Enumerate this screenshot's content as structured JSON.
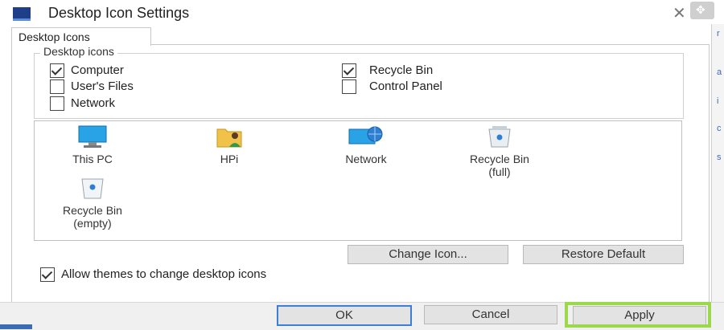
{
  "window": {
    "title": "Desktop Icon Settings",
    "close_glyph": "✕",
    "move_glyph": "✥"
  },
  "tabs": [
    {
      "label": "Desktop Icons"
    }
  ],
  "desktop_icons_group": {
    "legend": "Desktop icons",
    "checkboxes": [
      {
        "label": "Computer",
        "checked": true
      },
      {
        "label": "User's Files",
        "checked": false
      },
      {
        "label": "Network",
        "checked": false
      },
      {
        "label": "Recycle Bin",
        "checked": true
      },
      {
        "label": "Control Panel",
        "checked": false
      }
    ]
  },
  "icon_list": [
    {
      "line1": "This PC",
      "line2": "",
      "icon": "this-pc-icon"
    },
    {
      "line1": "HPi",
      "line2": "",
      "icon": "user-folder-icon"
    },
    {
      "line1": "Network",
      "line2": "",
      "icon": "network-icon"
    },
    {
      "line1": "Recycle Bin",
      "line2": "(full)",
      "icon": "recycle-bin-full-icon"
    },
    {
      "line1": "Recycle Bin",
      "line2": "(empty)",
      "icon": "recycle-bin-empty-icon"
    }
  ],
  "buttons": {
    "change_icon": "Change Icon...",
    "restore_default": "Restore Default",
    "ok": "OK",
    "cancel": "Cancel",
    "apply": "Apply"
  },
  "allow_themes": {
    "label": "Allow themes to change desktop icons",
    "checked": true
  },
  "colors": {
    "accent": "#3c7fd8",
    "highlight": "#9bd94a"
  },
  "right_edge_marks": [
    "r",
    "a",
    "i",
    "c",
    "s"
  ]
}
